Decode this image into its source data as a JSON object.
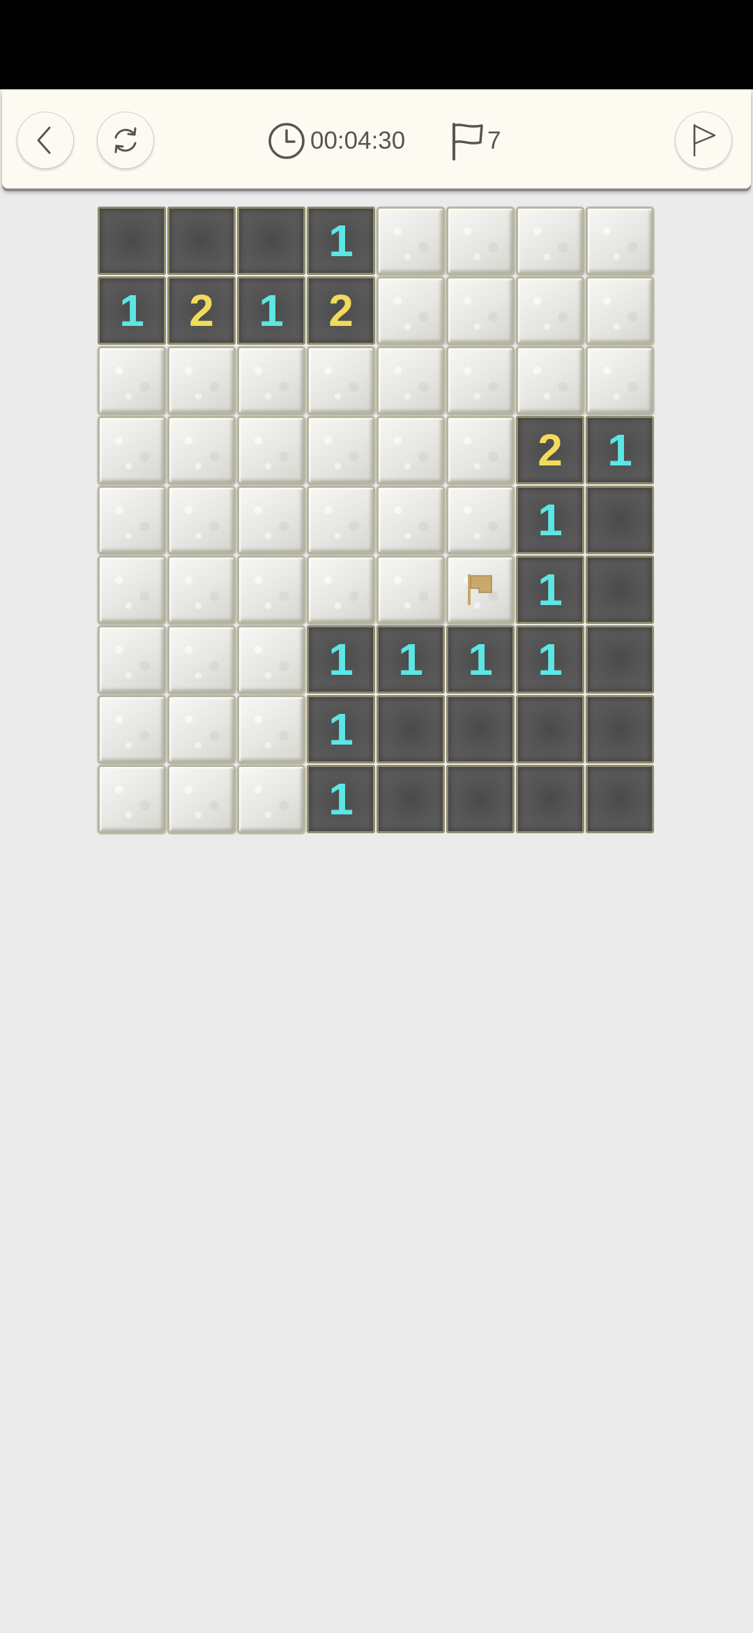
{
  "header": {
    "timer": "00:04:30",
    "flags_remaining": "7",
    "icons": {
      "back": "chevron-left-icon",
      "restart": "refresh-icon",
      "clock": "clock-icon",
      "flag_counter": "flag-icon",
      "flag_mode": "flag-outline-icon"
    }
  },
  "colors": {
    "number_1": "#5ce6e6",
    "number_2": "#f1da5c",
    "flag": "#c7a96b",
    "revealed_cell": "#555555",
    "hidden_cell": "#ececea"
  },
  "board": {
    "columns": 8,
    "rows": 9,
    "legend": "H = hidden, E = revealed empty, F = flagged, digit = revealed number",
    "cells": [
      [
        "E",
        "E",
        "E",
        "1",
        "H",
        "H",
        "H",
        "H"
      ],
      [
        "1",
        "2",
        "1",
        "2",
        "H",
        "H",
        "H",
        "H"
      ],
      [
        "H",
        "H",
        "H",
        "H",
        "H",
        "H",
        "H",
        "H"
      ],
      [
        "H",
        "H",
        "H",
        "H",
        "H",
        "H",
        "2",
        "1"
      ],
      [
        "H",
        "H",
        "H",
        "H",
        "H",
        "H",
        "1",
        "E"
      ],
      [
        "H",
        "H",
        "H",
        "H",
        "H",
        "F",
        "1",
        "E"
      ],
      [
        "H",
        "H",
        "H",
        "1",
        "1",
        "1",
        "1",
        "E"
      ],
      [
        "H",
        "H",
        "H",
        "1",
        "E",
        "E",
        "E",
        "E"
      ],
      [
        "H",
        "H",
        "H",
        "1",
        "E",
        "E",
        "E",
        "E"
      ]
    ]
  }
}
